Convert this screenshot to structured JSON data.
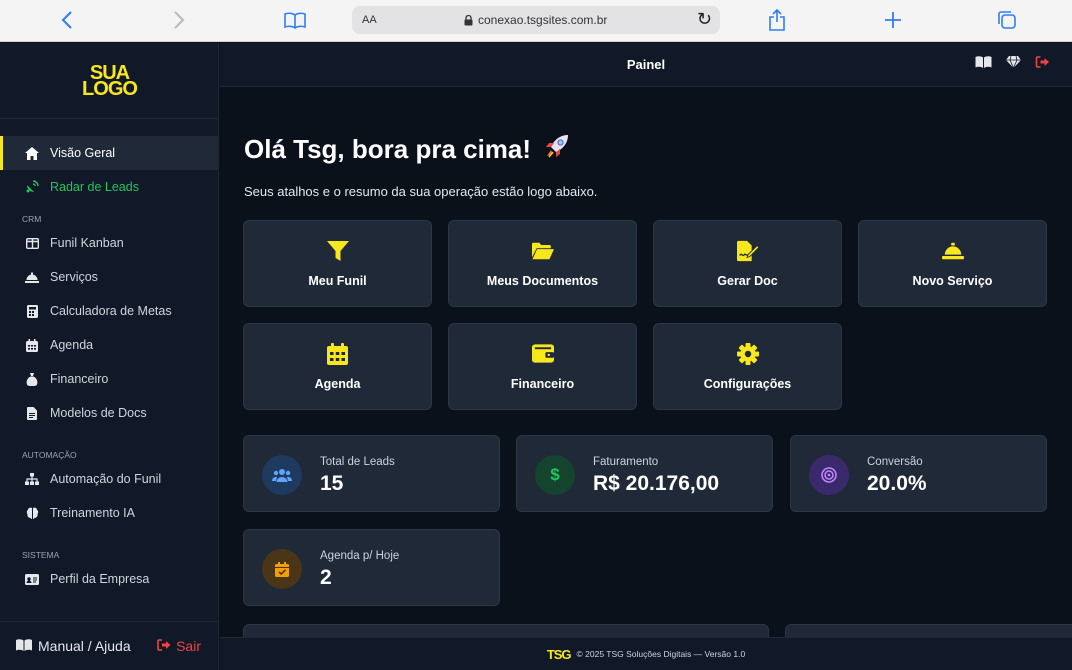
{
  "browser": {
    "url": "conexao.tsgsites.com.br",
    "aa": "AA"
  },
  "logo": {
    "line1": "SUA",
    "line2": "LOGO"
  },
  "sidebar": {
    "items": [
      {
        "label": "Visão Geral",
        "icon": "home-icon"
      },
      {
        "label": "Radar de Leads",
        "icon": "satellite-dish-icon"
      },
      {
        "section": "CRM"
      },
      {
        "label": "Funil Kanban",
        "icon": "columns-icon"
      },
      {
        "label": "Serviços",
        "icon": "bell-concierge-icon"
      },
      {
        "label": "Calculadora de Metas",
        "icon": "calculator-icon"
      },
      {
        "label": "Agenda",
        "icon": "calendar-icon"
      },
      {
        "label": "Financeiro",
        "icon": "money-bag-icon"
      },
      {
        "label": "Modelos de Docs",
        "icon": "file-icon"
      },
      {
        "section": "AUTOMAÇÃO"
      },
      {
        "label": "Automação do Funil",
        "icon": "sitemap-icon"
      },
      {
        "label": "Treinamento IA",
        "icon": "brain-icon"
      },
      {
        "section": "SISTEMA"
      },
      {
        "label": "Perfil da Empresa",
        "icon": "id-card-icon"
      }
    ],
    "manual_label": "Manual / Ajuda",
    "logout_label": "Sair"
  },
  "header": {
    "title": "Painel"
  },
  "main": {
    "greeting": "Olá Tsg, bora pra cima!",
    "subtitle": "Seus atalhos e o resumo da sua operação estão logo abaixo.",
    "shortcuts": [
      {
        "label": "Meu Funil",
        "icon": "filter-icon"
      },
      {
        "label": "Meus Documentos",
        "icon": "folder-open-icon"
      },
      {
        "label": "Gerar Doc",
        "icon": "file-signature-icon"
      },
      {
        "label": "Novo Serviço",
        "icon": "bell-concierge-icon"
      },
      {
        "label": "Agenda",
        "icon": "calendar-icon"
      },
      {
        "label": "Financeiro",
        "icon": "wallet-icon"
      },
      {
        "label": "Configurações",
        "icon": "gear-icon"
      }
    ],
    "stats": [
      {
        "label": "Total de Leads",
        "value": "15",
        "icon": "users-icon"
      },
      {
        "label": "Faturamento",
        "value": "R$ 20.176,00",
        "icon": "dollar-icon"
      },
      {
        "label": "Conversão",
        "value": "20.0%",
        "icon": "bullseye-icon"
      },
      {
        "label": "Agenda p/ Hoje",
        "value": "2",
        "icon": "calendar-check-icon"
      }
    ]
  },
  "footer": {
    "logo": "TSG",
    "text": "© 2025 TSG Soluções Digitais — Versão 1.0"
  },
  "colors": {
    "accent": "#f8e71c",
    "background": "#0b111b",
    "card": "#1f2937",
    "green": "#22c55e",
    "red": "#ef4444"
  }
}
